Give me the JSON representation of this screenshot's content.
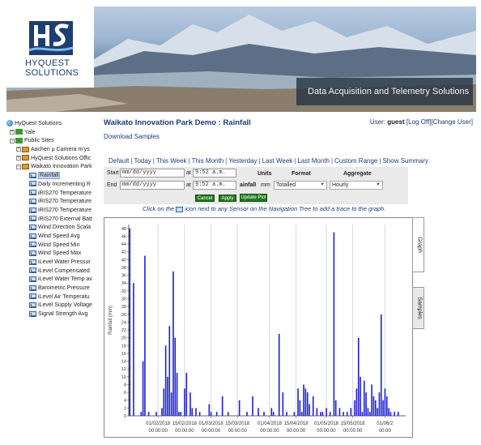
{
  "banner": {
    "logo_line1": "HYQUEST",
    "logo_line2": "SOLUTIONS",
    "tagline": "Data Acquisition and Telemetry Solutions"
  },
  "header": {
    "title": "Waikato Innovation Park Demo : Rainfall",
    "download": "Download Samples",
    "user_prefix": "User:",
    "user_name": "guest",
    "logoff": "[Log Off]",
    "change_user": "[Change User]"
  },
  "tree": {
    "root": "HyQuest Solutions",
    "yale": "Yale",
    "public_sites": "Public Sites",
    "sites": [
      "Aachen µ Camera m'ys",
      "HyQuest Solutions Offic",
      "Waikato Innovation Park"
    ],
    "sensors": [
      "Rainfall",
      "Daily Incrementing R",
      "iRIS270 Temperature",
      "iRIS270 Temperature",
      "iRIS270 Temperature",
      "iRIS270 External Batt",
      "Wind Direction Scala",
      "Wind Speed Avg",
      "Wind Speed Min",
      "Wind Speed Max",
      "iLevel Water Pressur",
      "iLevel Compensated",
      "iLevel Water Temp av",
      "Barometric Pressure",
      "iLevel Air Temperatu",
      "iLevel Supply Voltage",
      "Signal Strength Avg"
    ]
  },
  "range_links": [
    "Default",
    "Today",
    "This Week",
    "This Month",
    "Yesterday",
    "Last Week",
    "Last Month",
    "Custom Range",
    "Show Summary"
  ],
  "controls": {
    "start_label": "Start",
    "end_label": "End",
    "date_placeholder": "mm/dd/yyyy",
    "at": "at",
    "start_time": "9:52 a.m.",
    "end_time": "9:52 a.m.",
    "units_hdr": "Units",
    "format_hdr": "Format",
    "aggregate_hdr": "Aggregate",
    "sensor_short": "ainfall",
    "units": "mm",
    "format": "Totalled",
    "aggregate": "Hourly",
    "cancel": "Cancel",
    "apply": "Apply",
    "update": "Update Plot"
  },
  "hint": {
    "before": "Click on the",
    "after": "icon next to any Sensor on the Navigation Tree to add a trace to the graph."
  },
  "tabs": {
    "graph": "Graph",
    "samples": "Samples"
  },
  "colors": {
    "bar": "#1f1fd6",
    "title": "#1c3b77",
    "button": "#1f7a1f"
  },
  "chart_data": {
    "type": "bar",
    "ylabel": "Rainfall (mm)",
    "ylim": [
      0,
      49
    ],
    "yticks": [
      0,
      2,
      4,
      6,
      8,
      10,
      12,
      14,
      16,
      18,
      20,
      22,
      24,
      26,
      28,
      30,
      32,
      34,
      36,
      38,
      40,
      42,
      44,
      46,
      48
    ],
    "xlim": [
      -1.5,
      145
    ],
    "xtick_labels": [
      {
        "day": 14,
        "date": "01/02/2018",
        "time": "00:00:00"
      },
      {
        "day": 28,
        "date": "15/02/2018",
        "time": "00:00:00"
      },
      {
        "day": 42,
        "date": "01/03/2018",
        "time": "00:00:00"
      },
      {
        "day": 56,
        "date": "15/03/2018",
        "time": "00:00:00"
      },
      {
        "day": 73,
        "date": "01/04/2018",
        "time": "00:00:00"
      },
      {
        "day": 87,
        "date": "15/04/2018",
        "time": "00:00:00"
      },
      {
        "day": 103,
        "date": "01/05/2018",
        "time": "00:00:00"
      },
      {
        "day": 117,
        "date": "15/05/2018",
        "time": "00:00:00"
      },
      {
        "day": 134,
        "date": "01/06/2",
        "time": "00:00"
      }
    ],
    "points": [
      [
        -1,
        48
      ],
      [
        1,
        34
      ],
      [
        5,
        1
      ],
      [
        6,
        14
      ],
      [
        7,
        41
      ],
      [
        9,
        1
      ],
      [
        13,
        1
      ],
      [
        16,
        2
      ],
      [
        17,
        7
      ],
      [
        18,
        18
      ],
      [
        19,
        10
      ],
      [
        20,
        23
      ],
      [
        21,
        6
      ],
      [
        22,
        37
      ],
      [
        23,
        20
      ],
      [
        24,
        11
      ],
      [
        25,
        1
      ],
      [
        26,
        1
      ],
      [
        28,
        7
      ],
      [
        29,
        11
      ],
      [
        31,
        6
      ],
      [
        32,
        2
      ],
      [
        34,
        2
      ],
      [
        36,
        1
      ],
      [
        41,
        3
      ],
      [
        42,
        1
      ],
      [
        45,
        1
      ],
      [
        48,
        5
      ],
      [
        51,
        1
      ],
      [
        57,
        4
      ],
      [
        61,
        1
      ],
      [
        64,
        5
      ],
      [
        67,
        2
      ],
      [
        70,
        1
      ],
      [
        74,
        2
      ],
      [
        75,
        1
      ],
      [
        78,
        21
      ],
      [
        80,
        6
      ],
      [
        82,
        1
      ],
      [
        86,
        1
      ],
      [
        88,
        7
      ],
      [
        89,
        4
      ],
      [
        90,
        1
      ],
      [
        91,
        8
      ],
      [
        92,
        7
      ],
      [
        93,
        6
      ],
      [
        94,
        3
      ],
      [
        96,
        5
      ],
      [
        98,
        2
      ],
      [
        100,
        1
      ],
      [
        101,
        1
      ],
      [
        103,
        2
      ],
      [
        105,
        1
      ],
      [
        107,
        47
      ],
      [
        108,
        4
      ],
      [
        110,
        2
      ],
      [
        112,
        1
      ],
      [
        114,
        1
      ],
      [
        116,
        2
      ],
      [
        118,
        4
      ],
      [
        119,
        7
      ],
      [
        120,
        20
      ],
      [
        121,
        10
      ],
      [
        122,
        1
      ],
      [
        123,
        9
      ],
      [
        124,
        6
      ],
      [
        125,
        2
      ],
      [
        126,
        1
      ],
      [
        127,
        8
      ],
      [
        128,
        5
      ],
      [
        129,
        4
      ],
      [
        130,
        2
      ],
      [
        131,
        6
      ],
      [
        132,
        26
      ],
      [
        133,
        4
      ],
      [
        134,
        7
      ],
      [
        135,
        5
      ],
      [
        136,
        2
      ],
      [
        137,
        1
      ],
      [
        139,
        1
      ],
      [
        141,
        1
      ]
    ]
  }
}
